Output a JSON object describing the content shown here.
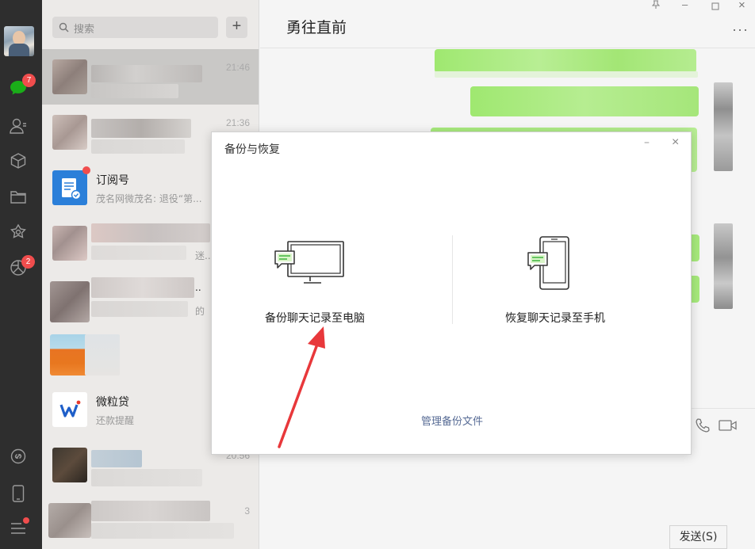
{
  "nav": {
    "chat_badge": "7",
    "moments_badge": "2"
  },
  "list": {
    "search_placeholder": "搜索",
    "plus_label": "+",
    "items": [
      {
        "time": "21:46"
      },
      {
        "time": "21:36"
      },
      {
        "name": "订阅号",
        "sub": "茂名网微茂名: 退役“第..."
      },
      {
        "sub": "迷..."
      },
      {
        "name": "..",
        "sub": "的"
      },
      {},
      {
        "name": "微粒贷",
        "sub": "还款提醒"
      },
      {
        "time": "20:56"
      },
      {
        "time": "3"
      }
    ]
  },
  "chat": {
    "title": "勇往直前",
    "send_label": "发送(S)",
    "pin_icon": "pin-icon",
    "min_icon": "minimize-icon",
    "max_icon": "maximize-icon",
    "close_icon": "close-icon",
    "more_label": "···"
  },
  "dialog": {
    "title": "备份与恢复",
    "min_label": "–",
    "close_label": "×",
    "backup_label": "备份聊天记录至电脑",
    "restore_label": "恢复聊天记录至手机",
    "manage_label": "管理备份文件"
  },
  "colors": {
    "accent_green": "#9fe870",
    "icon_green": "#3fb53f",
    "badge_red": "#f04d4d",
    "arrow_red": "#e8383b",
    "link_blue": "#576b95"
  }
}
